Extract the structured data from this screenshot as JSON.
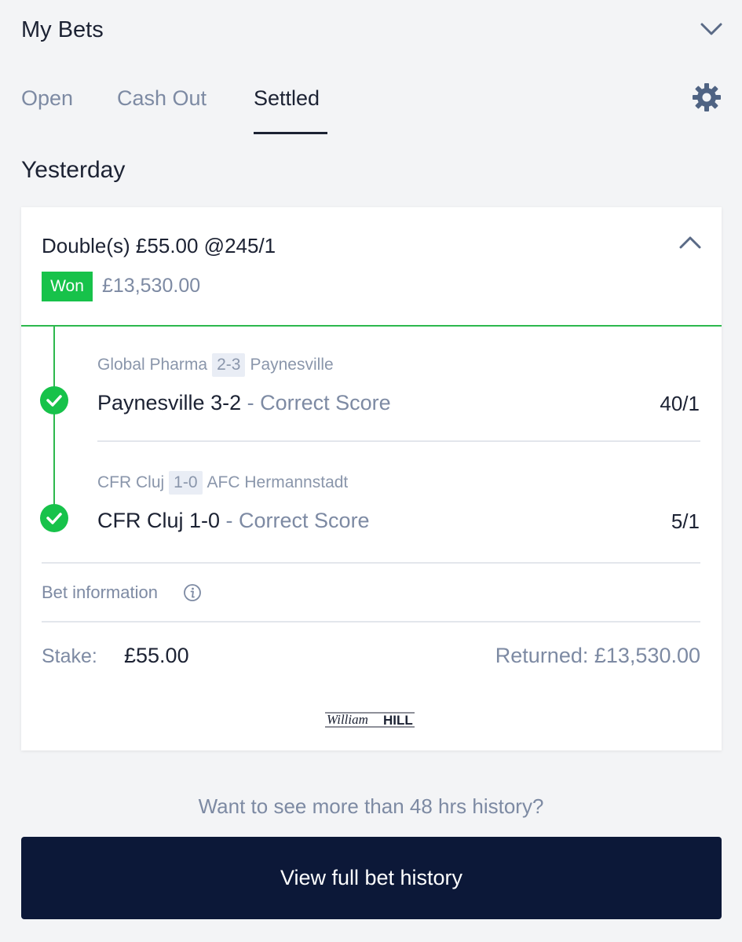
{
  "header": {
    "title": "My Bets",
    "collapse_icon": "chevron-down-icon"
  },
  "tabs": [
    {
      "label": "Open",
      "active": false
    },
    {
      "label": "Cash Out",
      "active": false
    },
    {
      "label": "Settled",
      "active": true
    }
  ],
  "settings_icon": "gear-icon",
  "section": {
    "title": "Yesterday"
  },
  "bet": {
    "heading": "Double(s) £55.00 @245/1",
    "status": "Won",
    "status_color": "#17c24a",
    "return_amount": "£13,530.00",
    "legs": [
      {
        "home": "Global Pharma",
        "score": "2-3",
        "away": "Paynesville",
        "selection": "Paynesville 3-2",
        "market": " - Correct Score",
        "odds": "40/1"
      },
      {
        "home": "CFR Cluj",
        "score": "1-0",
        "away": "AFC Hermannstadt",
        "selection": "CFR Cluj 1-0",
        "market": " - Correct Score",
        "odds": "5/1"
      }
    ],
    "info_label": "Bet information",
    "stake_label": "Stake:",
    "stake_value": "£55.00",
    "returned": "Returned: £13,530.00",
    "brand": "William HILL"
  },
  "history": {
    "question": "Want to see more than 48 hrs history?",
    "button_label": "View full bet history"
  },
  "colors": {
    "accent_green": "#17c24a",
    "navy": "#0c1838",
    "muted": "#7d8aa3"
  }
}
